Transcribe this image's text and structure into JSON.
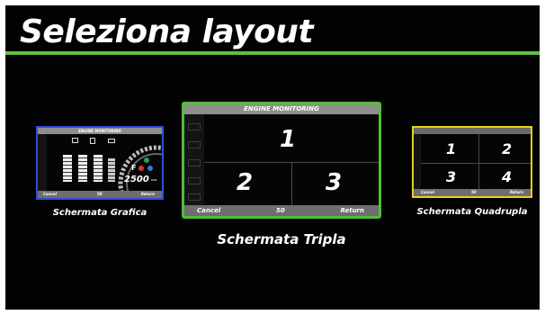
{
  "title": "Seleziona layout",
  "colors": {
    "accent_green": "#5fbf3e",
    "grafica_border": "#2d4fd6",
    "tripla_border": "#4fbf3a",
    "quadrupla_border": "#e6d21a"
  },
  "layouts": {
    "grafica": {
      "caption": "Schermata Grafica",
      "header": "ENGINE MONITORING",
      "footer": {
        "left": "Cancel",
        "center": "50",
        "right": "Return"
      },
      "gauge_value": "2500",
      "gauge_unit": "RPM",
      "gear": "F"
    },
    "tripla": {
      "caption": "Schermata Tripla",
      "header": "ENGINE MONITORING",
      "footer": {
        "left": "Cancel",
        "center": "50",
        "right": "Return"
      },
      "cells": [
        "1",
        "2",
        "3"
      ]
    },
    "quadrupla": {
      "caption": "Schermata Quadrupla",
      "footer": {
        "left": "Cancel",
        "center": "50",
        "right": "Return"
      },
      "cells": [
        "1",
        "2",
        "3",
        "4"
      ]
    }
  }
}
